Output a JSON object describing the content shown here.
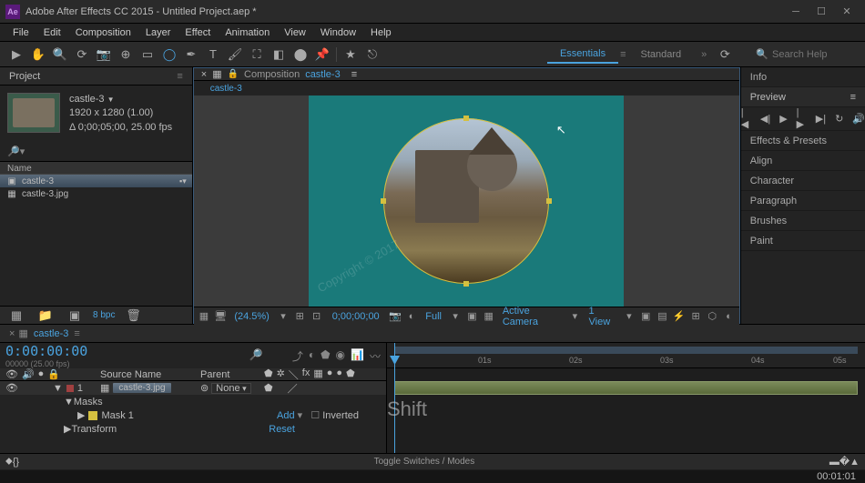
{
  "titlebar": {
    "app": "Adobe After Effects CC 2015",
    "project": "Untitled Project.aep *",
    "logo": "Ae"
  },
  "menu": [
    "File",
    "Edit",
    "Composition",
    "Layer",
    "Effect",
    "Animation",
    "View",
    "Window",
    "Help"
  ],
  "workspaces": {
    "active": "Essentials",
    "other": "Standard"
  },
  "search": {
    "placeholder": "Search Help"
  },
  "project": {
    "title": "Project",
    "asset_name": "castle-3",
    "asset_dims": "1920 x 1280 (1.00)",
    "asset_dur": "Δ 0;00;05;00, 25.00 fps",
    "name_header": "Name",
    "items": [
      {
        "type": "comp",
        "label": "castle-3",
        "selected": true
      },
      {
        "type": "img",
        "label": "castle-3.jpg",
        "selected": false
      }
    ],
    "bpc": "8 bpc"
  },
  "comp": {
    "label": "Composition",
    "name": "castle-3",
    "tab": "castle-3",
    "zoom": "(24.5%)",
    "time": "0;00;00;00",
    "res": "Full",
    "camera": "Active Camera",
    "views": "1 View"
  },
  "right_panels": [
    "Info",
    "Preview",
    "Effects & Presets",
    "Align",
    "Character",
    "Paragraph",
    "Brushes",
    "Paint"
  ],
  "timeline": {
    "tab": "castle-3",
    "timecode": "0:00:00:00",
    "fps": "00000 (25.00 fps)",
    "headers": {
      "source": "Source Name",
      "parent": "Parent"
    },
    "layer": {
      "num": "1",
      "name": "castle-3.jpg",
      "parent": "None"
    },
    "mask": "Masks",
    "mask1": "Mask 1",
    "transform": "Transform",
    "add": "Add",
    "inverted": "Inverted",
    "reset": "Reset",
    "ruler": [
      "01s",
      "02s",
      "03s",
      "04s",
      "05s"
    ],
    "switches": "Toggle Switches / Modes",
    "shift": "Shift"
  },
  "status": {
    "time": "00:01:01"
  },
  "watermark": "Copyright © 2017"
}
